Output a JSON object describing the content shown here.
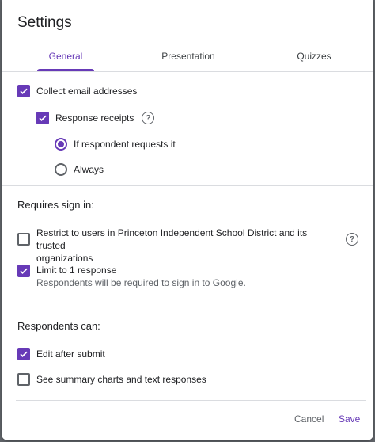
{
  "dialog": {
    "title": "Settings"
  },
  "tabs": [
    {
      "label": "General",
      "active": true
    },
    {
      "label": "Presentation",
      "active": false
    },
    {
      "label": "Quizzes",
      "active": false
    }
  ],
  "general": {
    "collect_email": {
      "label": "Collect email addresses",
      "checked": true
    },
    "response_receipts": {
      "label": "Response receipts",
      "checked": true
    },
    "receipt_options": [
      {
        "label": "If respondent requests it",
        "selected": true
      },
      {
        "label": "Always",
        "selected": false
      }
    ]
  },
  "requires_sign_in": {
    "heading": "Requires sign in:",
    "restrict": {
      "line1": "Restrict to users in Princeton Independent School District and its trusted",
      "line2": "organizations",
      "checked": false
    },
    "limit": {
      "label": "Limit to 1 response",
      "sub": "Respondents will be required to sign in to Google.",
      "checked": true
    }
  },
  "respondents_can": {
    "heading": "Respondents can:",
    "edit_after_submit": {
      "label": "Edit after submit",
      "checked": true
    },
    "see_summary": {
      "label": "See summary charts and text responses",
      "checked": false
    }
  },
  "footer": {
    "cancel": "Cancel",
    "save": "Save"
  },
  "colors": {
    "accent": "#673ab7",
    "divider": "#dadce0",
    "text": "#202124",
    "muted": "#5f6368"
  }
}
